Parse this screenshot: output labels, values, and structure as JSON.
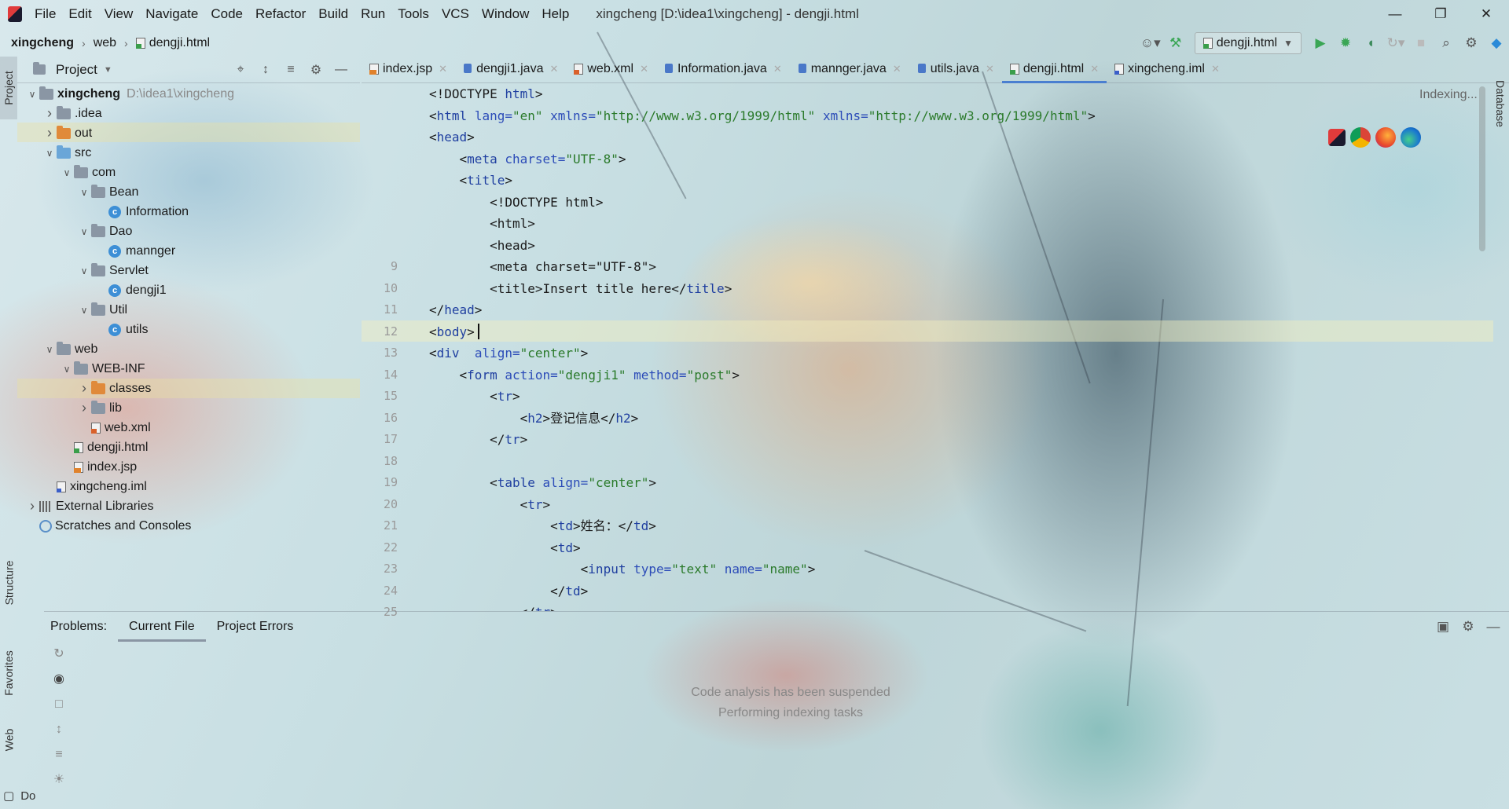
{
  "window": {
    "title": "xingcheng [D:\\idea1\\xingcheng] - dengji.html",
    "controls": [
      "minimize-icon",
      "restore-icon",
      "close-icon"
    ]
  },
  "menu": [
    "File",
    "Edit",
    "View",
    "Navigate",
    "Code",
    "Refactor",
    "Build",
    "Run",
    "Tools",
    "VCS",
    "Window",
    "Help"
  ],
  "breadcrumb": [
    "xingcheng",
    "web",
    "dengji.html"
  ],
  "toolbar": {
    "run_config": "dengji.html"
  },
  "project_panel": {
    "title": "Project",
    "tree": [
      {
        "label": "xingcheng",
        "path": "D:\\idea1\\xingcheng",
        "icon": "module-folder",
        "depth": 0,
        "expanded": true
      },
      {
        "label": ".idea",
        "icon": "folder",
        "depth": 1,
        "expanded": false
      },
      {
        "label": "out",
        "icon": "folder-orange",
        "depth": 1,
        "expanded": false
      },
      {
        "label": "src",
        "icon": "folder-blue",
        "depth": 1,
        "expanded": true
      },
      {
        "label": "com",
        "icon": "package",
        "depth": 2,
        "expanded": true
      },
      {
        "label": "Bean",
        "icon": "package",
        "depth": 3,
        "expanded": true
      },
      {
        "label": "Information",
        "icon": "class",
        "depth": 4
      },
      {
        "label": "Dao",
        "icon": "package",
        "depth": 3,
        "expanded": true
      },
      {
        "label": "mannger",
        "icon": "class",
        "depth": 4
      },
      {
        "label": "Servlet",
        "icon": "package",
        "depth": 3,
        "expanded": true
      },
      {
        "label": "dengji1",
        "icon": "class",
        "depth": 4
      },
      {
        "label": "Util",
        "icon": "package",
        "depth": 3,
        "expanded": true
      },
      {
        "label": "utils",
        "icon": "class",
        "depth": 4
      },
      {
        "label": "web",
        "icon": "web-folder",
        "depth": 1,
        "expanded": true
      },
      {
        "label": "WEB-INF",
        "icon": "folder",
        "depth": 2,
        "expanded": true
      },
      {
        "label": "classes",
        "icon": "folder-orange",
        "depth": 3,
        "expanded": false
      },
      {
        "label": "lib",
        "icon": "folder",
        "depth": 3,
        "expanded": false
      },
      {
        "label": "web.xml",
        "icon": "xml-file",
        "depth": 3
      },
      {
        "label": "dengji.html",
        "icon": "html-file",
        "depth": 2
      },
      {
        "label": "index.jsp",
        "icon": "jsp-file",
        "depth": 2
      },
      {
        "label": "xingcheng.iml",
        "icon": "iml-file",
        "depth": 1
      },
      {
        "label": "External Libraries",
        "icon": "libraries",
        "depth": 0,
        "expanded": false
      },
      {
        "label": "Scratches and Consoles",
        "icon": "scratches",
        "depth": 0
      }
    ]
  },
  "tabs": [
    {
      "label": "index.jsp",
      "icon": "jsp-file"
    },
    {
      "label": "dengji1.java",
      "icon": "java-file"
    },
    {
      "label": "web.xml",
      "icon": "xml-file"
    },
    {
      "label": "Information.java",
      "icon": "java-file"
    },
    {
      "label": "mannger.java",
      "icon": "java-file"
    },
    {
      "label": "utils.java",
      "icon": "java-file"
    },
    {
      "label": "dengji.html",
      "icon": "html-file",
      "active": true
    },
    {
      "label": "xingcheng.iml",
      "icon": "iml-file"
    }
  ],
  "editor": {
    "status": "Indexing...",
    "current_line": 12,
    "lines": [
      {
        "n": "",
        "html": "&lt;!DOCTYPE <span class='tg'>html</span>&gt;"
      },
      {
        "n": "",
        "html": "&lt;<span class='tg'>html</span> <span class='at'>lang=</span><span class='av'>\"en\"</span> <span class='at'>xmlns=</span><span class='av'>\"http://www.w3.org/1999/html\"</span> <span class='at'>xmlns=</span><span class='av'>\"http://www.w3.org/1999/html\"</span>&gt;"
      },
      {
        "n": "",
        "html": "&lt;<span class='tg'>head</span>&gt;"
      },
      {
        "n": "",
        "html": "    &lt;<span class='tg'>meta</span> <span class='at'>charset=</span><span class='av'>\"UTF-8\"</span>&gt;"
      },
      {
        "n": "",
        "html": "    &lt;<span class='tg'>title</span>&gt;"
      },
      {
        "n": "",
        "html": "        &lt;!DOCTYPE html&gt;"
      },
      {
        "n": "",
        "html": "        &lt;html&gt;"
      },
      {
        "n": "",
        "html": "        &lt;head&gt;"
      },
      {
        "n": "9",
        "html": "        &lt;meta charset=\"UTF-8\"&gt;"
      },
      {
        "n": "10",
        "html": "        &lt;title&gt;Insert title here&lt;/<span class='tg'>title</span>&gt;"
      },
      {
        "n": "11",
        "html": "&lt;/<span class='tg'>head</span>&gt;"
      },
      {
        "n": "12",
        "html": "&lt;<span class='tg'>body</span>&gt;"
      },
      {
        "n": "13",
        "html": "&lt;<span class='tg'>div</span>  <span class='at'>align=</span><span class='av'>\"center\"</span>&gt;"
      },
      {
        "n": "14",
        "html": "    &lt;<span class='tg'>form</span> <span class='at'>action=</span><span class='av'>\"dengji1\"</span> <span class='at'>method=</span><span class='av'>\"post\"</span>&gt;"
      },
      {
        "n": "15",
        "html": "        &lt;<span class='tg'>tr</span>&gt;"
      },
      {
        "n": "16",
        "html": "            &lt;<span class='tg'>h2</span>&gt;登记信息&lt;/<span class='tg'>h2</span>&gt;"
      },
      {
        "n": "17",
        "html": "        &lt;/<span class='tg'>tr</span>&gt;"
      },
      {
        "n": "18",
        "html": ""
      },
      {
        "n": "19",
        "html": "        &lt;<span class='tg'>table</span> <span class='at'>align=</span><span class='av'>\"center\"</span>&gt;"
      },
      {
        "n": "20",
        "html": "            &lt;<span class='tg'>tr</span>&gt;"
      },
      {
        "n": "21",
        "html": "                &lt;<span class='tg'>td</span>&gt;姓名：&lt;/<span class='tg'>td</span>&gt;"
      },
      {
        "n": "22",
        "html": "                &lt;<span class='tg'>td</span>&gt;"
      },
      {
        "n": "23",
        "html": "                    &lt;<span class='tg'>input</span> <span class='at'>type=</span><span class='av'>\"text\"</span> <span class='at'>name=</span><span class='av'>\"name\"</span>&gt;"
      },
      {
        "n": "24",
        "html": "                &lt;/<span class='tg'>td</span>&gt;"
      },
      {
        "n": "25",
        "html": "            &lt;/<span class='tg'>tr</span>&gt;"
      }
    ]
  },
  "left_tool_windows": [
    "Project",
    "Structure",
    "Favorites",
    "Web"
  ],
  "right_tool_windows": [
    "Database"
  ],
  "problems": {
    "label": "Problems:",
    "tabs": [
      "Current File",
      "Project Errors"
    ],
    "active_tab": "Current File",
    "message_line1": "Code analysis has been suspended",
    "message_line2": "Performing indexing tasks"
  },
  "bottom_stub": "Do",
  "colors": {
    "accent": "#4a7fd0",
    "tag": "#1f3fa0",
    "attr_value": "#2a7a2a",
    "run_green": "#3aa655"
  }
}
